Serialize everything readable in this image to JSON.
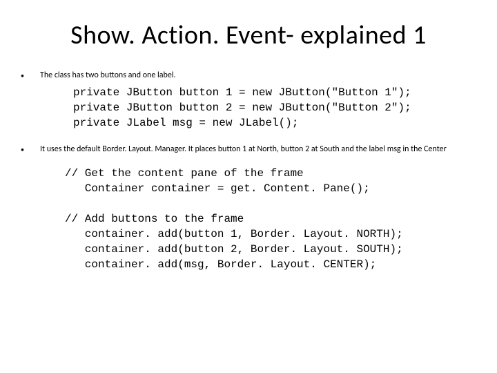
{
  "title": "Show. Action. Event- explained 1",
  "bullets": [
    "The class has two buttons and one label.",
    "It uses the default Border. Layout. Manager. It places button 1 at North, button 2 at South and the label msg in the Center"
  ],
  "code1": "private JButton button 1 = new JButton(\"Button 1\");\nprivate JButton button 2 = new JButton(\"Button 2\");\nprivate JLabel msg = new JLabel();",
  "code2": "// Get the content pane of the frame\n   Container container = get. Content. Pane();\n\n// Add buttons to the frame\n   container. add(button 1, Border. Layout. NORTH);\n   container. add(button 2, Border. Layout. SOUTH);\n   container. add(msg, Border. Layout. CENTER);"
}
